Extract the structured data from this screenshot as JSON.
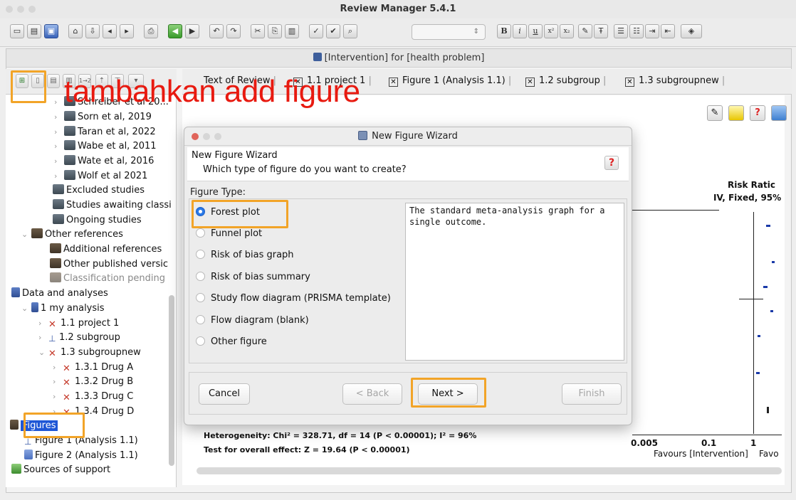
{
  "app": {
    "title": "Review Manager 5.4.1"
  },
  "window": {
    "title": "[Intervention] for [health problem]"
  },
  "toolbar": {
    "format_buttons": [
      "B",
      "i",
      "u",
      "x²",
      "x₂"
    ],
    "nav_prev": "◀",
    "nav_next": "▶"
  },
  "sidebar": {
    "items": [
      {
        "label": "Schreiber et al 20..."
      },
      {
        "label": "Sorn et al, 2019"
      },
      {
        "label": "Taran et al, 2022"
      },
      {
        "label": "Wabe et al, 2011"
      },
      {
        "label": "Wate et al, 2016"
      },
      {
        "label": "Wolf et al 2021"
      },
      {
        "label": "Excluded studies"
      },
      {
        "label": "Studies awaiting classi"
      },
      {
        "label": "Ongoing studies"
      },
      {
        "label": "Other references"
      },
      {
        "label": "Additional references"
      },
      {
        "label": "Other published versic"
      },
      {
        "label": "Classification pending"
      },
      {
        "label": "Data and analyses"
      },
      {
        "label": "1 my analysis"
      },
      {
        "label": "1.1 project 1"
      },
      {
        "label": "1.2 subgroup"
      },
      {
        "label": "1.3 subgroupnew"
      },
      {
        "label": "1.3.1 Drug A"
      },
      {
        "label": "1.3.2 Drug B"
      },
      {
        "label": "1.3.3 Drug C"
      },
      {
        "label": "1.3.4 Drug D"
      },
      {
        "label": "Figures"
      },
      {
        "label": "Figure 1 (Analysis 1.1)"
      },
      {
        "label": "Figure 2 (Analysis 1.1)"
      },
      {
        "label": "Sources of support"
      }
    ]
  },
  "tabs": [
    {
      "label": "Text of Review"
    },
    {
      "label": "1.1 project 1"
    },
    {
      "label": "Figure 1 (Analysis 1.1)"
    },
    {
      "label": "1.2 subgroup"
    },
    {
      "label": "1.3 subgroupnew"
    }
  ],
  "annotation": {
    "text": "tambahkan add figure"
  },
  "plot": {
    "header_title": "Risk Ratic",
    "header_sub": "IV, Fixed, 95%",
    "heterogeneity": "Heterogeneity: Chi² = 328.71, df = 14 (P < 0.00001); I² = 96%",
    "overall": "Test for overall effect: Z = 19.64 (P < 0.00001)",
    "ticks": [
      "0.005",
      "0.1",
      "1"
    ],
    "favours_left": "Favours [Intervention]",
    "favours_right": "Favo"
  },
  "dialog": {
    "title": "New Figure Wizard",
    "header_title": "New Figure Wizard",
    "header_question": "Which type of figure do you want to create?",
    "section_label": "Figure Type:",
    "options": [
      {
        "label": "Forest plot",
        "selected": true
      },
      {
        "label": "Funnel plot",
        "selected": false
      },
      {
        "label": "Risk of bias graph",
        "selected": false
      },
      {
        "label": "Risk of bias summary",
        "selected": false
      },
      {
        "label": "Study flow diagram (PRISMA template)",
        "selected": false
      },
      {
        "label": "Flow diagram (blank)",
        "selected": false
      },
      {
        "label": "Other figure",
        "selected": false
      }
    ],
    "description": "The standard meta-analysis graph for a single outcome.",
    "buttons": {
      "cancel": "Cancel",
      "back": "< Back",
      "next": "Next >",
      "finish": "Finish"
    }
  },
  "colors": {
    "annotation": "#e81a10",
    "highlight_box": "#f2a428",
    "selection": "#1f57d6"
  }
}
